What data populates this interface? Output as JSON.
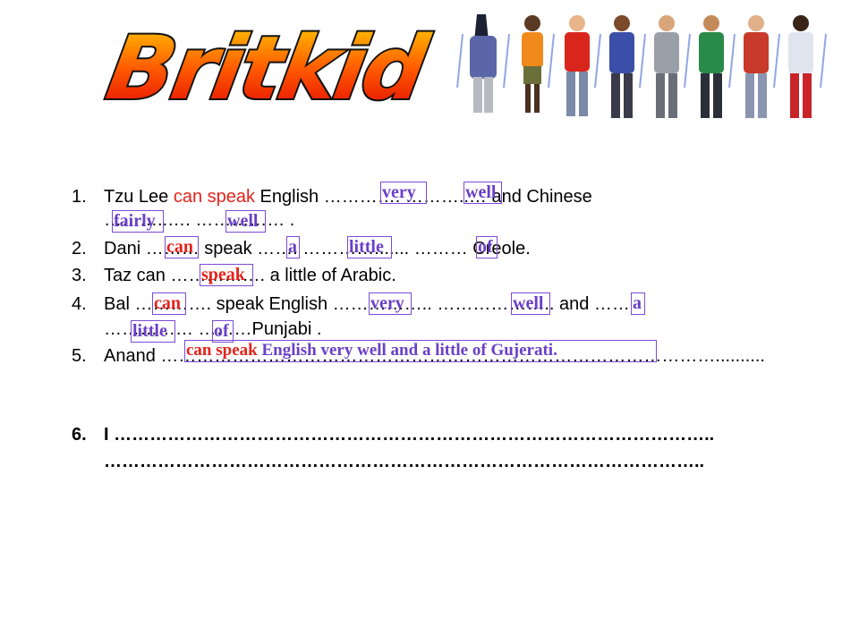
{
  "logo": {
    "text": "Britkid"
  },
  "items": [
    {
      "num": "1.",
      "parts": [
        "Tzu Lee ",
        "can speak",
        " English …………. ………..… and Chinese"
      ]
    },
    {
      "cont": "………..…. ……………   ."
    },
    {
      "num": "2.",
      "parts": [
        "Dani ……… speak ……. …………....... ……… Creole."
      ]
    },
    {
      "num": "3.",
      "parts": [
        "Taz can ……………. a little of Arabic."
      ]
    },
    {
      "num": "4.",
      "parts": [
        "Bal …………. speak English …………….. ……………….. and ……"
      ]
    },
    {
      "cont": "…………… ………Punjabi ."
    },
    {
      "num": "5.",
      "parts": [
        "Anand ………………………………………………………………………………….........."
      ]
    },
    {
      "num": "6.",
      "parts": [
        "I ……………………………………………………………………………………….."
      ]
    },
    {
      "cont": "……………………………………………………………………………………….."
    }
  ],
  "answers": {
    "a1_very": "very",
    "a1_well": "well",
    "a1_fairly": "fairly",
    "a1_well2": "well",
    "a2_can": "can",
    "a2_a": "a",
    "a2_little": "little",
    "a2_of": "of",
    "a3_speak": "speak",
    "a4_can": "can",
    "a4_very": "very",
    "a4_well": "well",
    "a4_a": "a",
    "a4_little": "little",
    "a4_of": "of",
    "a5": "can speak English very well and a little of Gujerati."
  },
  "colors": {
    "accent": "#6a3fc8",
    "red": "#e4231c",
    "box": "#7b4bd6"
  }
}
